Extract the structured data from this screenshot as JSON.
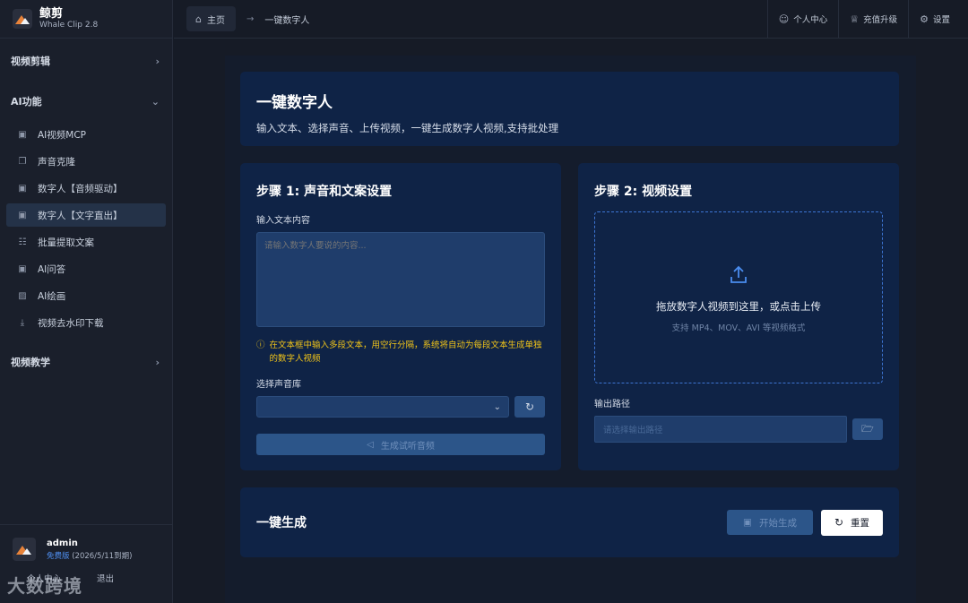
{
  "app": {
    "name": "鲸剪",
    "version": "Whale Clip 2.8"
  },
  "sidebar": {
    "sections": [
      {
        "label": "视频剪辑",
        "expanded": false
      },
      {
        "label": "AI功能",
        "expanded": true
      },
      {
        "label": "视频教学",
        "expanded": false
      }
    ],
    "items": [
      {
        "label": "AI视频MCP",
        "icon": "doc-icon"
      },
      {
        "label": "声音克隆",
        "icon": "copy-icon"
      },
      {
        "label": "数字人【音频驱动】",
        "icon": "doc-icon"
      },
      {
        "label": "数字人【文字直出】",
        "icon": "doc-icon",
        "active": true
      },
      {
        "label": "批量提取文案",
        "icon": "file-icon"
      },
      {
        "label": "AI问答",
        "icon": "doc-icon"
      },
      {
        "label": "AI绘画",
        "icon": "image-icon"
      },
      {
        "label": "视频去水印下载",
        "icon": "download-icon"
      }
    ]
  },
  "user": {
    "name": "admin",
    "plan": "免费版",
    "expiry": "(2026/5/11到期)",
    "links": [
      "个人中心",
      "退出"
    ]
  },
  "watermark": "大数跨境",
  "topbar": {
    "home": "主页",
    "current": "一键数字人",
    "actions": [
      "个人中心",
      "充值升级",
      "设置"
    ]
  },
  "hero": {
    "title": "一键数字人",
    "subtitle": "输入文本、选择声音、上传视频，一键生成数字人视频,支持批处理"
  },
  "step1": {
    "title": "步骤 1: 声音和文案设置",
    "text_label": "输入文本内容",
    "text_placeholder": "请输入数字人要说的内容...",
    "hint": "在文本框中输入多段文本，用空行分隔，系统将自动为每段文本生成单独的数字人视频",
    "voice_label": "选择声音库",
    "voice_value": "",
    "generate_label": "生成试听音频"
  },
  "step2": {
    "title": "步骤 2: 视频设置",
    "drop_main": "拖放数字人视频到这里，或点击上传",
    "drop_sub": "支持 MP4、MOV、AVI 等视频格式",
    "output_label": "输出路径",
    "output_placeholder": "请选择输出路径"
  },
  "generate": {
    "title": "一键生成",
    "start_label": "开始生成",
    "reset_label": "重置"
  },
  "colors": {
    "accent": "#3d75d3",
    "card": "#0f2346",
    "warning": "#f0c419",
    "plan": "#4f8ff0"
  }
}
